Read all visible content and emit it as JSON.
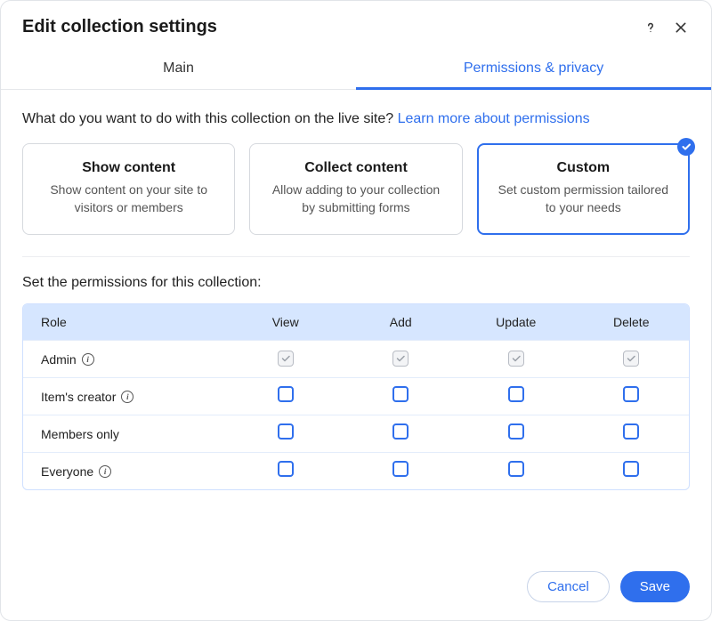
{
  "header": {
    "title": "Edit collection settings"
  },
  "tabs": {
    "main": "Main",
    "permissions": "Permissions & privacy"
  },
  "question": {
    "text": "What do you want to do with this collection on the live site? ",
    "link": "Learn more about permissions"
  },
  "cards": {
    "show": {
      "title": "Show content",
      "desc": "Show content on your site to visitors or members"
    },
    "collect": {
      "title": "Collect content",
      "desc": "Allow adding to your collection by submitting forms"
    },
    "custom": {
      "title": "Custom",
      "desc": "Set custom permission tailored to your needs"
    }
  },
  "permissions": {
    "section_title": "Set the permissions for this collection:",
    "columns": {
      "role": "Role",
      "view": "View",
      "add": "Add",
      "update": "Update",
      "delete": "Delete"
    },
    "rows": {
      "admin": "Admin",
      "creator": "Item's creator",
      "members": "Members only",
      "everyone": "Everyone"
    }
  },
  "footer": {
    "cancel": "Cancel",
    "save": "Save"
  }
}
